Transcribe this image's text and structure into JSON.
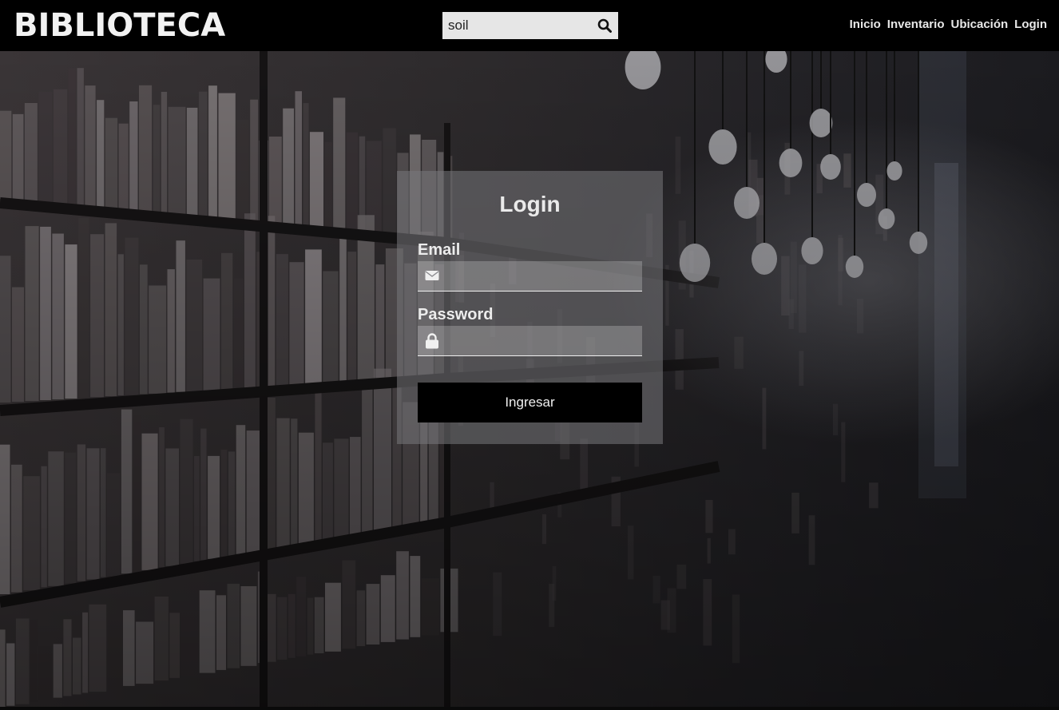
{
  "header": {
    "brand": "BIBLIOTECA",
    "search": {
      "value": "soil",
      "icon": "search-icon"
    },
    "nav": [
      {
        "label": "Inicio"
      },
      {
        "label": "Inventario"
      },
      {
        "label": "Ubicación"
      },
      {
        "label": "Login"
      }
    ]
  },
  "login": {
    "title": "Login",
    "email_label": "Email",
    "email_value": "",
    "email_icon": "envelope-icon",
    "password_label": "Password",
    "password_value": "",
    "password_icon": "lock-icon",
    "submit_label": "Ingresar"
  },
  "colors": {
    "header_bg": "#000000",
    "text_light": "#ececec",
    "search_bg": "#e6e6e6",
    "button_bg": "#000000"
  }
}
